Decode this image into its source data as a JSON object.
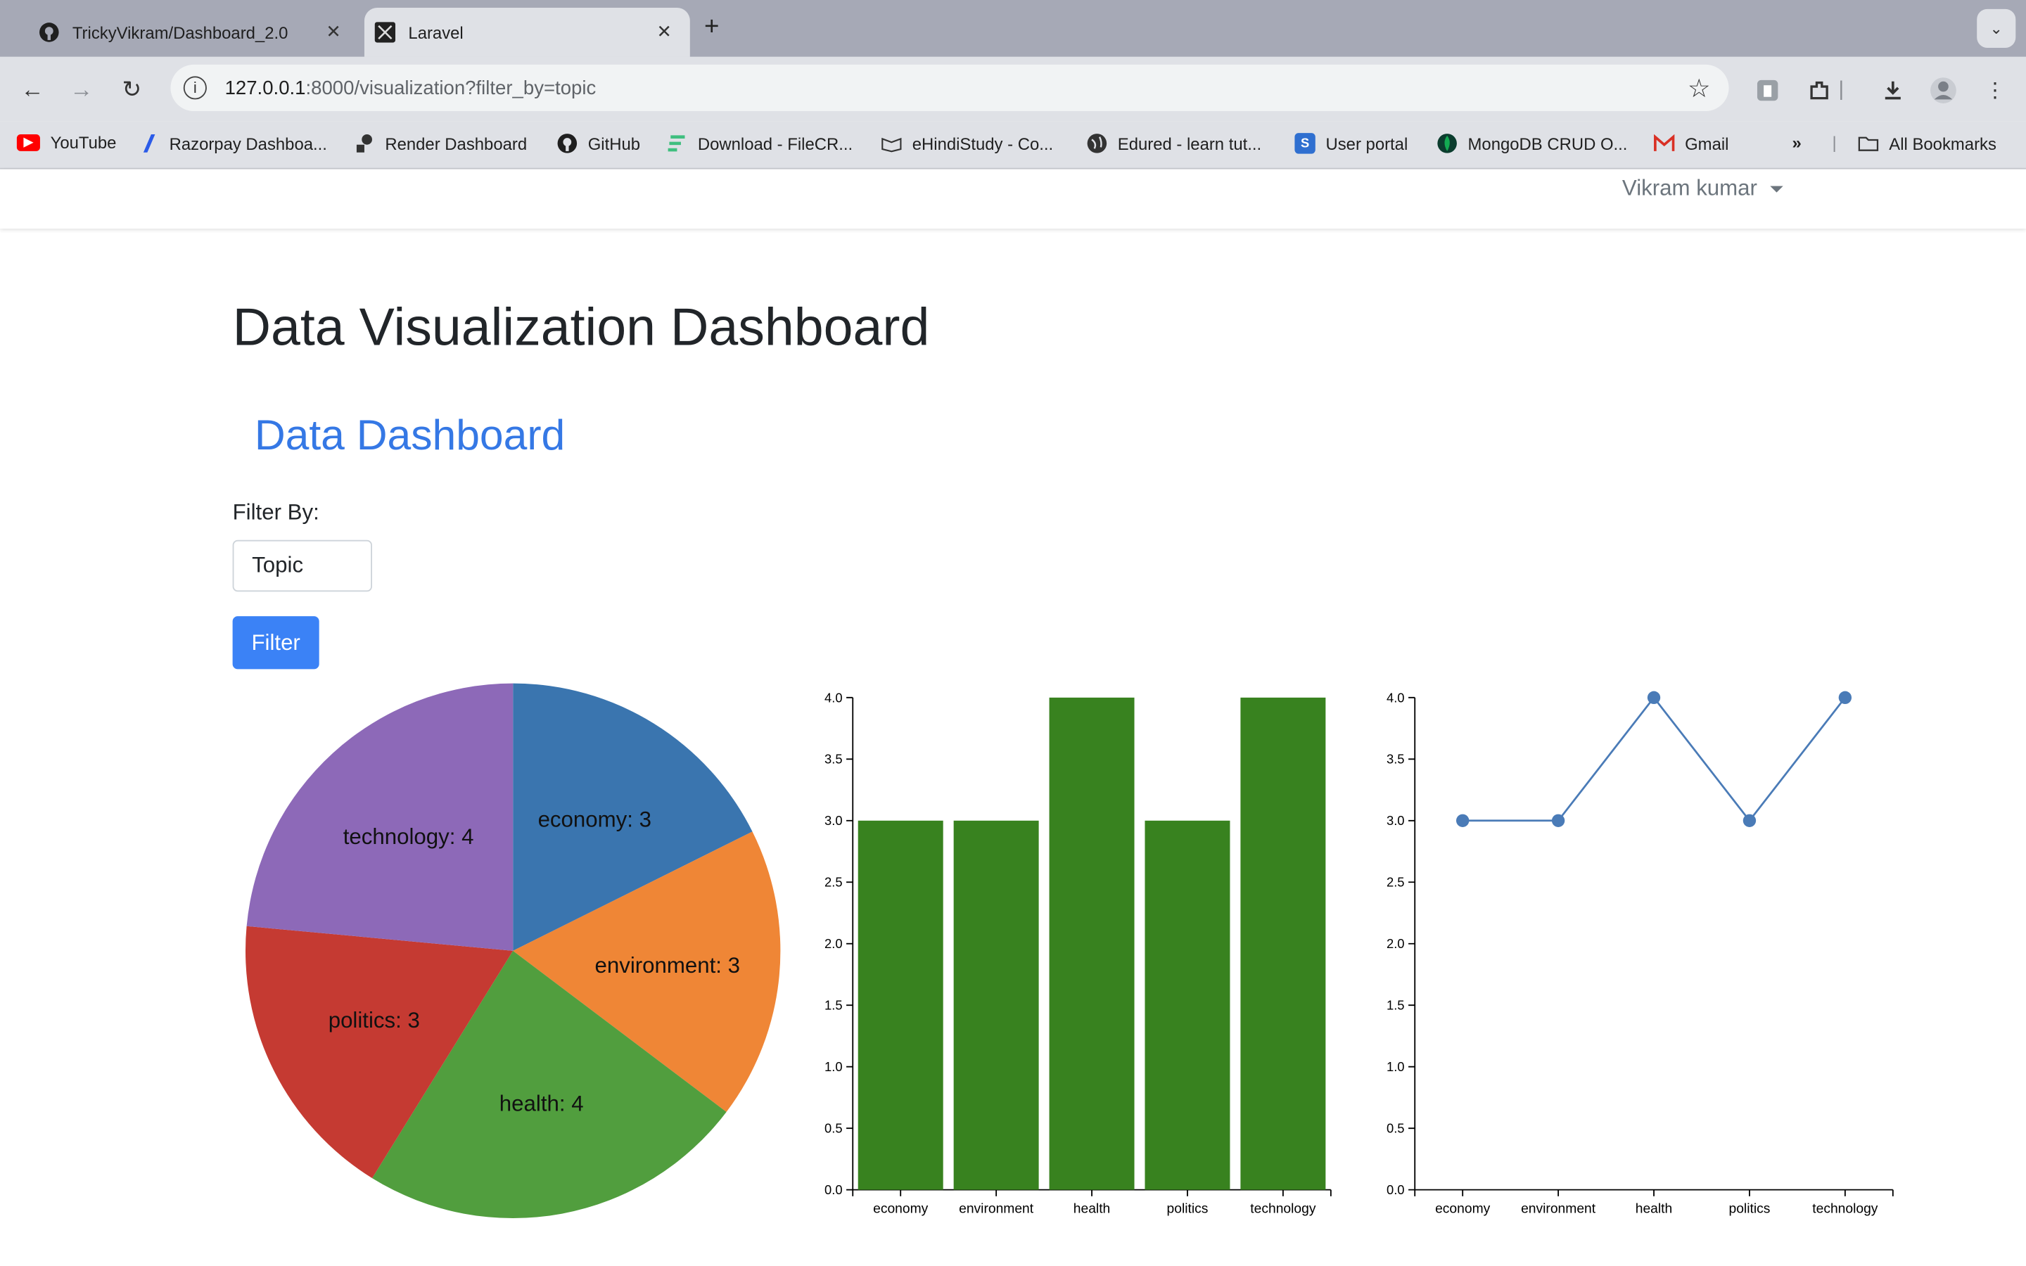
{
  "browser": {
    "tabs": [
      {
        "title": "TrickyVikram/Dashboard_2.0",
        "icon": "github-icon"
      },
      {
        "title": "Laravel",
        "icon": "laravel-icon"
      }
    ],
    "url_host": "127.0.0.1",
    "url_rest": ":8000/visualization?filter_by=topic",
    "bookmarks": [
      {
        "label": "YouTube",
        "icon": "youtube-icon",
        "color": "#ff0000"
      },
      {
        "label": "Razorpay Dashboa...",
        "icon": "razorpay-icon",
        "color": "#2b5be8"
      },
      {
        "label": "Render Dashboard",
        "icon": "render-icon",
        "color": "#222222"
      },
      {
        "label": "GitHub",
        "icon": "github-icon",
        "color": "#222222"
      },
      {
        "label": "Download - FileCR...",
        "icon": "filecr-icon",
        "color": "#3fbf7f"
      },
      {
        "label": "eHindiStudy - Co...",
        "icon": "book-icon",
        "color": "#555555"
      },
      {
        "label": "Edured - learn tut...",
        "icon": "globe-icon",
        "color": "#333333"
      },
      {
        "label": "User portal",
        "icon": "portal-icon",
        "color": "#2f6fd0"
      },
      {
        "label": "MongoDB CRUD O...",
        "icon": "mongodb-icon",
        "color": "#13aa52"
      },
      {
        "label": "Gmail",
        "icon": "gmail-icon",
        "color": "#d93025"
      }
    ],
    "all_bookmarks": "All Bookmarks"
  },
  "app": {
    "user_name": "Vikram kumar",
    "page_title": "Data Visualization Dashboard",
    "section_title": "Data Dashboard",
    "filter_label": "Filter By:",
    "filter_value": "Topic",
    "filter_button": "Filter"
  },
  "chart_data": [
    {
      "type": "pie",
      "labels": [
        "economy",
        "environment",
        "health",
        "politics",
        "technology"
      ],
      "values": [
        3,
        3,
        4,
        3,
        4
      ],
      "slice_labels": [
        "economy: 3",
        "environment: 3",
        "health: 4",
        "politics: 3",
        "technology: 4"
      ],
      "colors": [
        "#3a75af",
        "#ef8636",
        "#519e3e",
        "#c53a32",
        "#8d69b8"
      ]
    },
    {
      "type": "bar",
      "categories": [
        "economy",
        "environment",
        "health",
        "politics",
        "technology"
      ],
      "values": [
        3,
        3,
        4,
        3,
        4
      ],
      "ylim": [
        0,
        4
      ],
      "yticks": [
        "0.0",
        "0.5",
        "1.0",
        "1.5",
        "2.0",
        "2.5",
        "3.0",
        "3.5",
        "4.0"
      ],
      "color": "#38821f"
    },
    {
      "type": "line",
      "categories": [
        "economy",
        "environment",
        "health",
        "politics",
        "technology"
      ],
      "values": [
        3,
        3,
        4,
        3,
        4
      ],
      "ylim": [
        0,
        4
      ],
      "yticks": [
        "0.0",
        "0.5",
        "1.0",
        "1.5",
        "2.0",
        "2.5",
        "3.0",
        "3.5",
        "4.0"
      ],
      "color": "#4a7bb7"
    }
  ]
}
